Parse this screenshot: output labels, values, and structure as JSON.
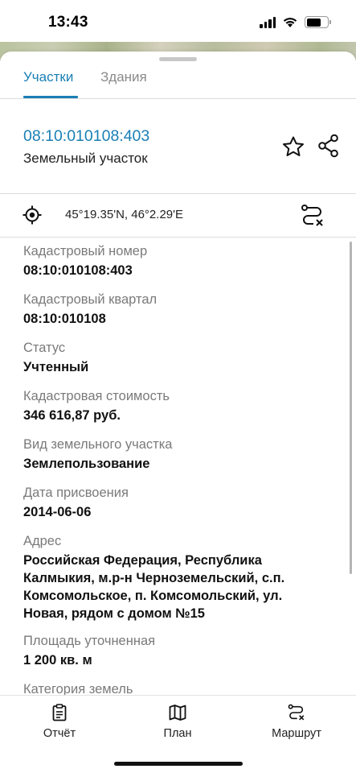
{
  "status_bar": {
    "time": "13:43"
  },
  "tabs": [
    {
      "label": "Участки",
      "active": true
    },
    {
      "label": "Здания",
      "active": false
    }
  ],
  "parcel": {
    "id": "08:10:010108:403",
    "type": "Земельный участок"
  },
  "coordinates": "45°19.35'N, 46°2.29'E",
  "fields": [
    {
      "label": "Кадастровый номер",
      "value": "08:10:010108:403"
    },
    {
      "label": "Кадастровый квартал",
      "value": "08:10:010108"
    },
    {
      "label": "Статус",
      "value": "Учтенный"
    },
    {
      "label": "Кадастровая стоимость",
      "value": "346 616,87 руб."
    },
    {
      "label": "Вид земельного участка",
      "value": "Землепользование"
    },
    {
      "label": "Дата присвоения",
      "value": "2014-06-06"
    },
    {
      "label": "Адрес",
      "value": "Российская Федерация, Республика Калмыкия, м.р-н Черноземельский, с.п. Комсомольское, п. Комсомольский, ул. Новая, рядом с домом №15"
    },
    {
      "label": "Площадь уточненная",
      "value": "1 200 кв. м"
    },
    {
      "label": "Категория земель",
      "value": ""
    }
  ],
  "bottom_nav": [
    {
      "label": "Отчёт",
      "icon": "report-icon"
    },
    {
      "label": "План",
      "icon": "map-icon"
    },
    {
      "label": "Маршрут",
      "icon": "route-icon"
    }
  ],
  "colors": {
    "accent": "#1a7fb5"
  }
}
